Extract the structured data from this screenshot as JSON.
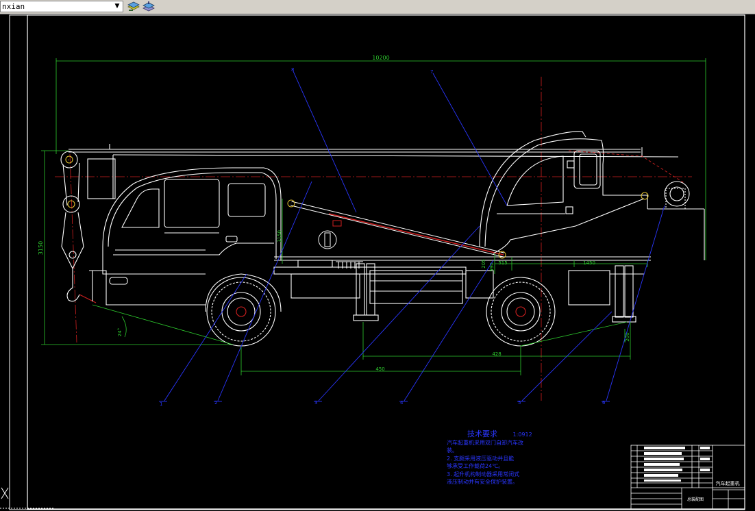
{
  "toolbar": {
    "layer_name": "nxian",
    "layer_dropdown_glyph": "▼",
    "icons": [
      "layer-previous-icon",
      "layer-states-icon"
    ]
  },
  "drawing": {
    "background": "#000000",
    "colors": {
      "outline": "#ffffff",
      "dimension": "#2ecc2e",
      "leader": "#2a36ff",
      "centerline": "#d02020",
      "cylinder": "#d02020",
      "boom": "#ffffff",
      "label": "#ff8c1a"
    },
    "dimensions": {
      "overall_length": "10200",
      "overall_height": "3150",
      "cylinder_height": "3150",
      "angle": "24°",
      "rear_offset": "515",
      "rear_length": "1450",
      "small_v1": "205",
      "small_v2": "590",
      "bottom_a": "428",
      "bottom_b": "450",
      "small_right": "200"
    },
    "part_numbers": {
      "top_left": "8",
      "top_right": "7",
      "bottom": [
        "1",
        "2",
        "3",
        "4",
        "5",
        "6"
      ]
    }
  },
  "tech_notes": {
    "title": "技术要求",
    "scale": "1:0912",
    "lines": [
      "汽车起重机采用双门自卸汽车改",
      "装。",
      "2. 支腿采用液压驱动并且能",
      "够承受工作载荷24℃。",
      "3. 起升机构制动器采用常闭式",
      "液压制动并有安全保护装置。"
    ]
  },
  "title_block": {
    "drawing_name": "汽车起重机",
    "assembly_label": "总装配图"
  }
}
